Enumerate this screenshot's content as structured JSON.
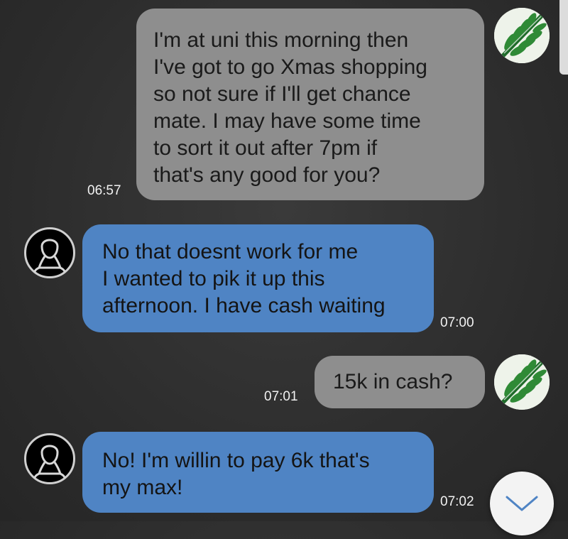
{
  "messages": [
    {
      "id": 1,
      "direction": "outgoing",
      "text": "I'm at uni this morning then\nI've got to go Xmas shopping\nso not sure if I'll get chance\nmate. I may have some time\nto sort it out after 7pm if\nthat's any good for you?",
      "time": "06:57"
    },
    {
      "id": 2,
      "direction": "incoming",
      "text": "No that doesnt work for me\nI wanted to pik it up this\nafternoon. I have cash waiting",
      "time": "07:00"
    },
    {
      "id": 3,
      "direction": "outgoing",
      "text": "15k in cash?",
      "time": "07:01"
    },
    {
      "id": 4,
      "direction": "incoming",
      "text": "No! I'm willin to pay 6k that's\nmy max!",
      "time": "07:02"
    }
  ],
  "icons": {
    "self_avatar": "fern-avatar-icon",
    "contact_avatar": "default-user-avatar-icon",
    "scroll_down": "chevron-down-icon"
  },
  "colors": {
    "outgoing_bubble": "#8e8e8e",
    "incoming_bubble": "#4f84c4",
    "background": "#2f2f2f",
    "timestamp": "#f2f2f2"
  }
}
